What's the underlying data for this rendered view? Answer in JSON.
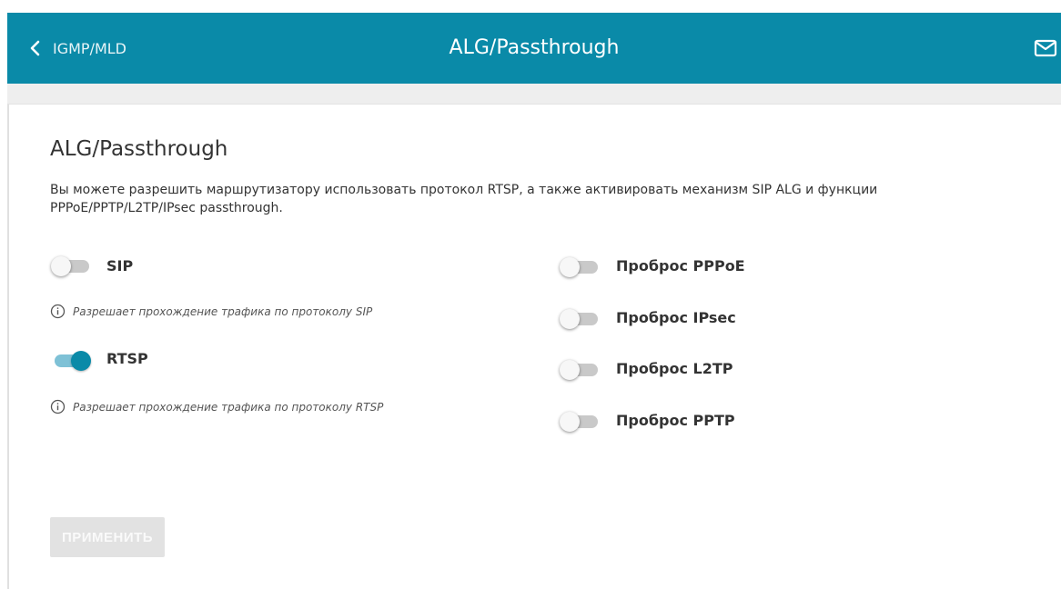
{
  "header": {
    "back_label": "IGMP/MLD",
    "title": "ALG/Passthrough",
    "icons": {
      "back": "chevron-left-icon",
      "notifications": "mail-icon"
    },
    "colors": {
      "bar": "#0a8aa8",
      "toggle_on": "#0a8aa8"
    }
  },
  "content": {
    "section_title": "ALG/Passthrough",
    "description": "Вы можете разрешить маршрутизатору использовать протокол RTSP, а также активировать механизм SIP ALG и функции PPPoE/PPTP/L2TP/IPsec passthrough.",
    "left_options": [
      {
        "label": "SIP",
        "enabled": false,
        "hint": "Разрешает прохождение трафика по протоколу SIP"
      },
      {
        "label": "RTSP",
        "enabled": true,
        "hint": "Разрешает прохождение трафика по протоколу RTSP"
      }
    ],
    "right_options": [
      {
        "label": "Проброс PPPoE",
        "enabled": false
      },
      {
        "label": "Проброс IPsec",
        "enabled": false
      },
      {
        "label": "Проброс L2TP",
        "enabled": false
      },
      {
        "label": "Проброс PPTP",
        "enabled": false
      }
    ],
    "apply_button": "ПРИМЕНИТЬ"
  }
}
